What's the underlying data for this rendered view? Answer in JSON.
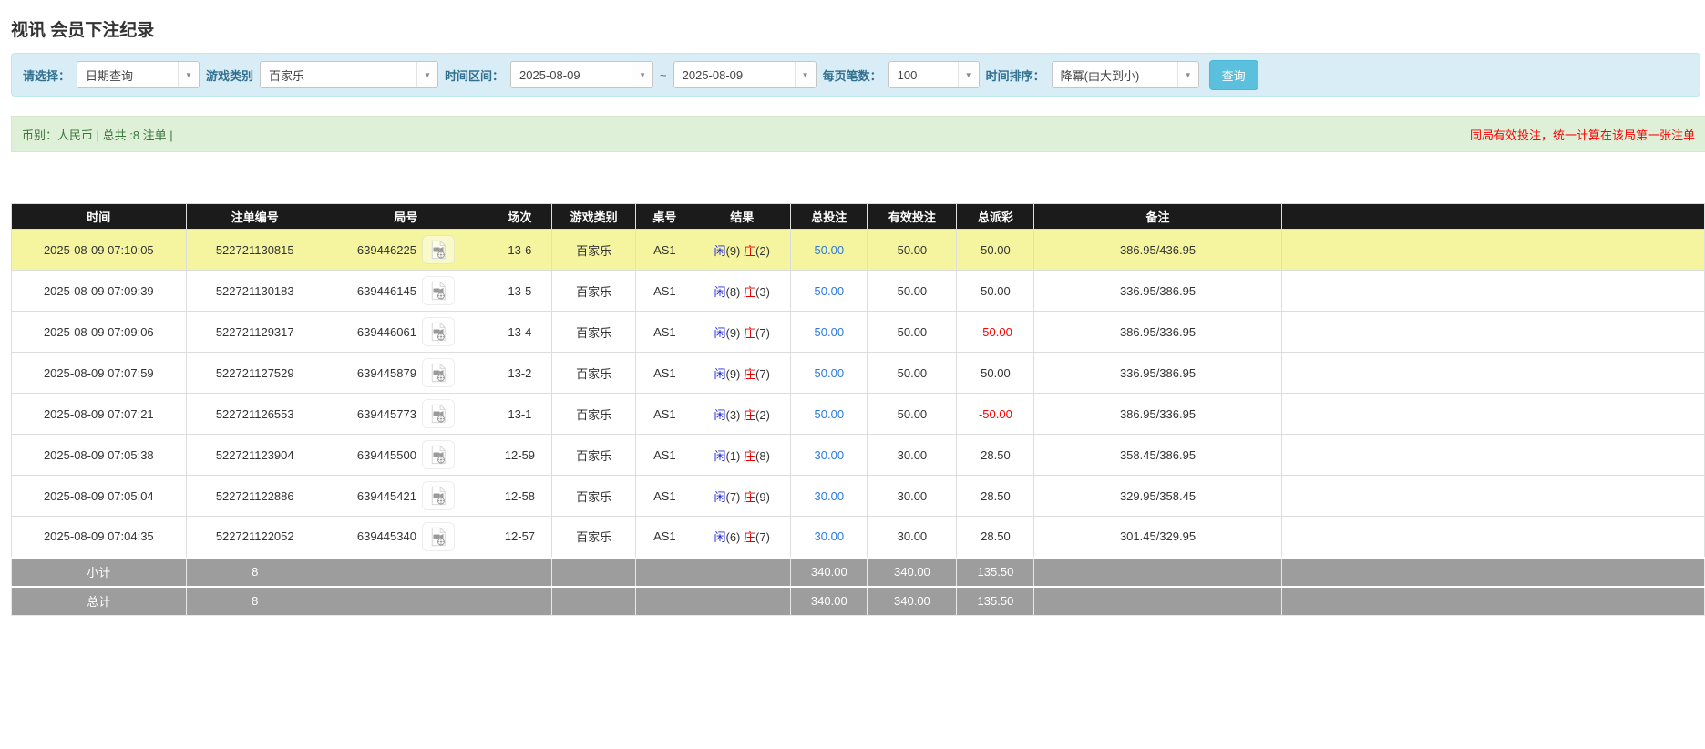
{
  "page": {
    "title": "视讯 会员下注纪录"
  },
  "filters": {
    "select_label": "请选择：",
    "select_value": "日期查询",
    "game_label": "游戏类别",
    "game_value": "百家乐",
    "range_label": "时间区间：",
    "date_from": "2025-08-09",
    "tilde": "~",
    "date_to": "2025-08-09",
    "page_size_label": "每页笔数：",
    "page_size_value": "100",
    "sort_label": "时间排序：",
    "sort_value": "降冪(由大到小)",
    "search_button": "查询"
  },
  "summary_bar": {
    "left_text": "币别：人民币 | 总共 :8 注单 |",
    "right_text": "同局有效投注，统一计算在该局第一张注单"
  },
  "table": {
    "headers": [
      "时间",
      "注单编号",
      "局号",
      "场次",
      "游戏类别",
      "桌号",
      "结果",
      "总投注",
      "有效投注",
      "总派彩",
      "备注"
    ],
    "rows": [
      {
        "time": "2025-08-09 07:10:05",
        "bet_no": "522721130815",
        "round_no": "639446225",
        "session": "13-6",
        "game": "百家乐",
        "table_no": "AS1",
        "player_label": "闲",
        "player_score": "(9)",
        "banker_label": "庄",
        "banker_score": "(2)",
        "total_bet": "50.00",
        "valid_bet": "50.00",
        "payout": "50.00",
        "payout_negative": false,
        "note": "386.95/436.95",
        "highlight": true
      },
      {
        "time": "2025-08-09 07:09:39",
        "bet_no": "522721130183",
        "round_no": "639446145",
        "session": "13-5",
        "game": "百家乐",
        "table_no": "AS1",
        "player_label": "闲",
        "player_score": "(8)",
        "banker_label": "庄",
        "banker_score": "(3)",
        "total_bet": "50.00",
        "valid_bet": "50.00",
        "payout": "50.00",
        "payout_negative": false,
        "note": "336.95/386.95",
        "highlight": false
      },
      {
        "time": "2025-08-09 07:09:06",
        "bet_no": "522721129317",
        "round_no": "639446061",
        "session": "13-4",
        "game": "百家乐",
        "table_no": "AS1",
        "player_label": "闲",
        "player_score": "(9)",
        "banker_label": "庄",
        "banker_score": "(7)",
        "total_bet": "50.00",
        "valid_bet": "50.00",
        "payout": "-50.00",
        "payout_negative": true,
        "note": "386.95/336.95",
        "highlight": false
      },
      {
        "time": "2025-08-09 07:07:59",
        "bet_no": "522721127529",
        "round_no": "639445879",
        "session": "13-2",
        "game": "百家乐",
        "table_no": "AS1",
        "player_label": "闲",
        "player_score": "(9)",
        "banker_label": "庄",
        "banker_score": "(7)",
        "total_bet": "50.00",
        "valid_bet": "50.00",
        "payout": "50.00",
        "payout_negative": false,
        "note": "336.95/386.95",
        "highlight": false
      },
      {
        "time": "2025-08-09 07:07:21",
        "bet_no": "522721126553",
        "round_no": "639445773",
        "session": "13-1",
        "game": "百家乐",
        "table_no": "AS1",
        "player_label": "闲",
        "player_score": "(3)",
        "banker_label": "庄",
        "banker_score": "(2)",
        "total_bet": "50.00",
        "valid_bet": "50.00",
        "payout": "-50.00",
        "payout_negative": true,
        "note": "386.95/336.95",
        "highlight": false
      },
      {
        "time": "2025-08-09 07:05:38",
        "bet_no": "522721123904",
        "round_no": "639445500",
        "session": "12-59",
        "game": "百家乐",
        "table_no": "AS1",
        "player_label": "闲",
        "player_score": "(1)",
        "banker_label": "庄",
        "banker_score": "(8)",
        "total_bet": "30.00",
        "valid_bet": "30.00",
        "payout": "28.50",
        "payout_negative": false,
        "note": "358.45/386.95",
        "highlight": false
      },
      {
        "time": "2025-08-09 07:05:04",
        "bet_no": "522721122886",
        "round_no": "639445421",
        "session": "12-58",
        "game": "百家乐",
        "table_no": "AS1",
        "player_label": "闲",
        "player_score": "(7)",
        "banker_label": "庄",
        "banker_score": "(9)",
        "total_bet": "30.00",
        "valid_bet": "30.00",
        "payout": "28.50",
        "payout_negative": false,
        "note": "329.95/358.45",
        "highlight": false
      },
      {
        "time": "2025-08-09 07:04:35",
        "bet_no": "522721122052",
        "round_no": "639445340",
        "session": "12-57",
        "game": "百家乐",
        "table_no": "AS1",
        "player_label": "闲",
        "player_score": "(6)",
        "banker_label": "庄",
        "banker_score": "(7)",
        "total_bet": "30.00",
        "valid_bet": "30.00",
        "payout": "28.50",
        "payout_negative": false,
        "note": "301.45/329.95",
        "highlight": false
      }
    ],
    "subtotal": {
      "label": "小计",
      "count": "8",
      "total_bet": "340.00",
      "valid_bet": "340.00",
      "payout": "135.50"
    },
    "total": {
      "label": "总计",
      "count": "8",
      "total_bet": "340.00",
      "valid_bet": "340.00",
      "payout": "135.50"
    }
  },
  "icons": {
    "combobox_caret": "▼",
    "video_replay": "video-camera-document-icon"
  },
  "colors": {
    "accent_button": "#5bc0de",
    "highlight_row": "#f5f5a0",
    "summary_row": "#9d9d9d",
    "player_blue": "#2328dc",
    "banker_red": "#e60000",
    "amount_link_blue": "#2a7ae2",
    "negative_red": "#ff0000",
    "header_black": "#1b1b1b",
    "filter_panel_blue": "#d9edf7",
    "summary_panel_green": "#dff0d8",
    "notice_red": "#ff0000"
  }
}
